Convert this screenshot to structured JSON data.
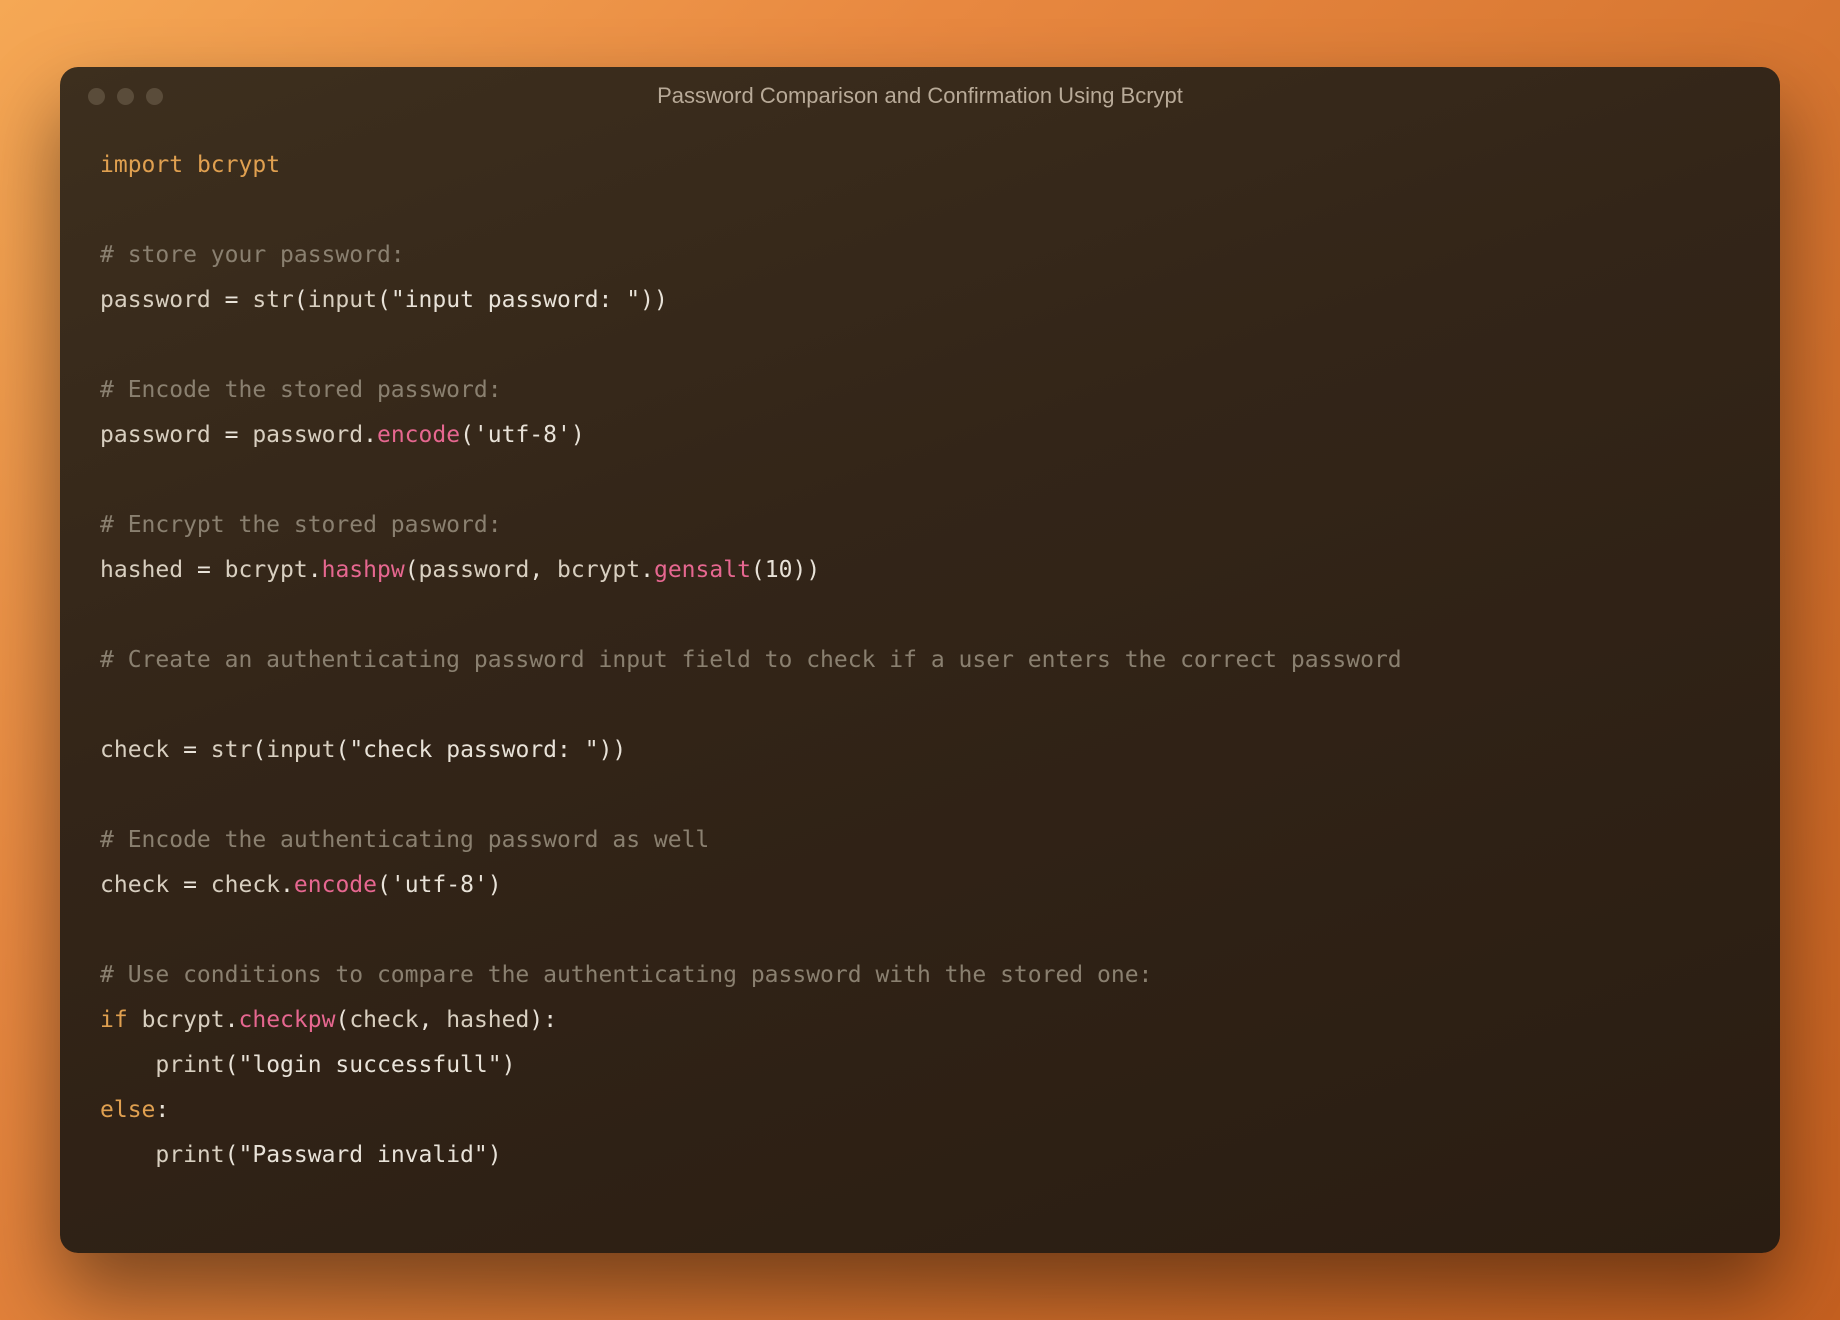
{
  "window": {
    "title": "Password Comparison and Confirmation Using Bcrypt"
  },
  "code": {
    "line1_kw_import": "import",
    "line1_mod": "bcrypt",
    "line3_comment": "# store your password:",
    "line4_var_password": "password",
    "line4_eq": " = ",
    "line4_str": "str",
    "line4_input": "input",
    "line4_lit": "\"input password: \"",
    "line6_comment": "# Encode the stored password:",
    "line7_var_password": "password",
    "line7_eq": " = ",
    "line7_password2": "password",
    "line7_encode": "encode",
    "line7_lit": "'utf-8'",
    "line9_comment": "# Encrypt the stored pasword:",
    "line10_var_hashed": "hashed",
    "line10_eq": " = ",
    "line10_bcrypt": "bcrypt",
    "line10_hashpw": "hashpw",
    "line10_password": "password",
    "line10_bcrypt2": "bcrypt",
    "line10_gensalt": "gensalt",
    "line10_num": "10",
    "line12_comment": "# Create an authenticating password input field to check if a user enters the correct password",
    "line14_var_check": "check",
    "line14_eq": " = ",
    "line14_str": "str",
    "line14_input": "input",
    "line14_lit": "\"check password: \"",
    "line16_comment": "# Encode the authenticating password as well",
    "line17_var_check": "check",
    "line17_eq": " = ",
    "line17_check2": "check",
    "line17_encode": "encode",
    "line17_lit": "'utf-8'",
    "line19_comment": "# Use conditions to compare the authenticating password with the stored one:",
    "line20_if": "if",
    "line20_bcrypt": "bcrypt",
    "line20_checkpw": "checkpw",
    "line20_check": "check",
    "line20_hashed": "hashed",
    "line21_print": "print",
    "line21_lit": "\"login successfull\"",
    "line22_else": "else",
    "line23_print": "print",
    "line23_lit": "\"Passward invalid\""
  }
}
